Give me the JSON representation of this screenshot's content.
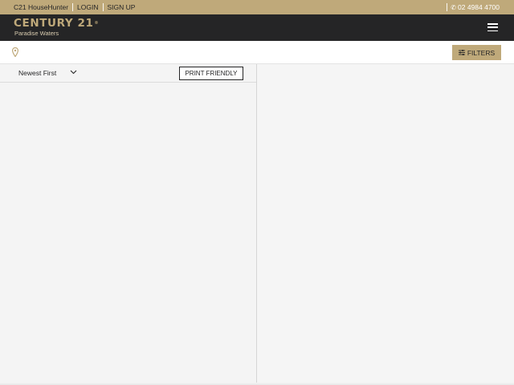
{
  "topbar": {
    "househunter": "C21 HouseHunter",
    "login": "LOGIN",
    "signup": "SIGN UP",
    "phone": "02 4984 4700"
  },
  "brand": {
    "name": "CENTURY 21",
    "registered": "®",
    "office": "Paradise Waters"
  },
  "search": {
    "filters_label": "FILTERS"
  },
  "listings": {
    "sort_value": "Newest First",
    "print_label": "PRINT FRIENDLY"
  },
  "colors": {
    "brand_gold": "#bfa97a",
    "header_dark": "#252526"
  },
  "icons": [
    "phone-icon",
    "hamburger-menu-icon",
    "map-pin-icon",
    "sliders-icon",
    "chevron-down-icon"
  ]
}
